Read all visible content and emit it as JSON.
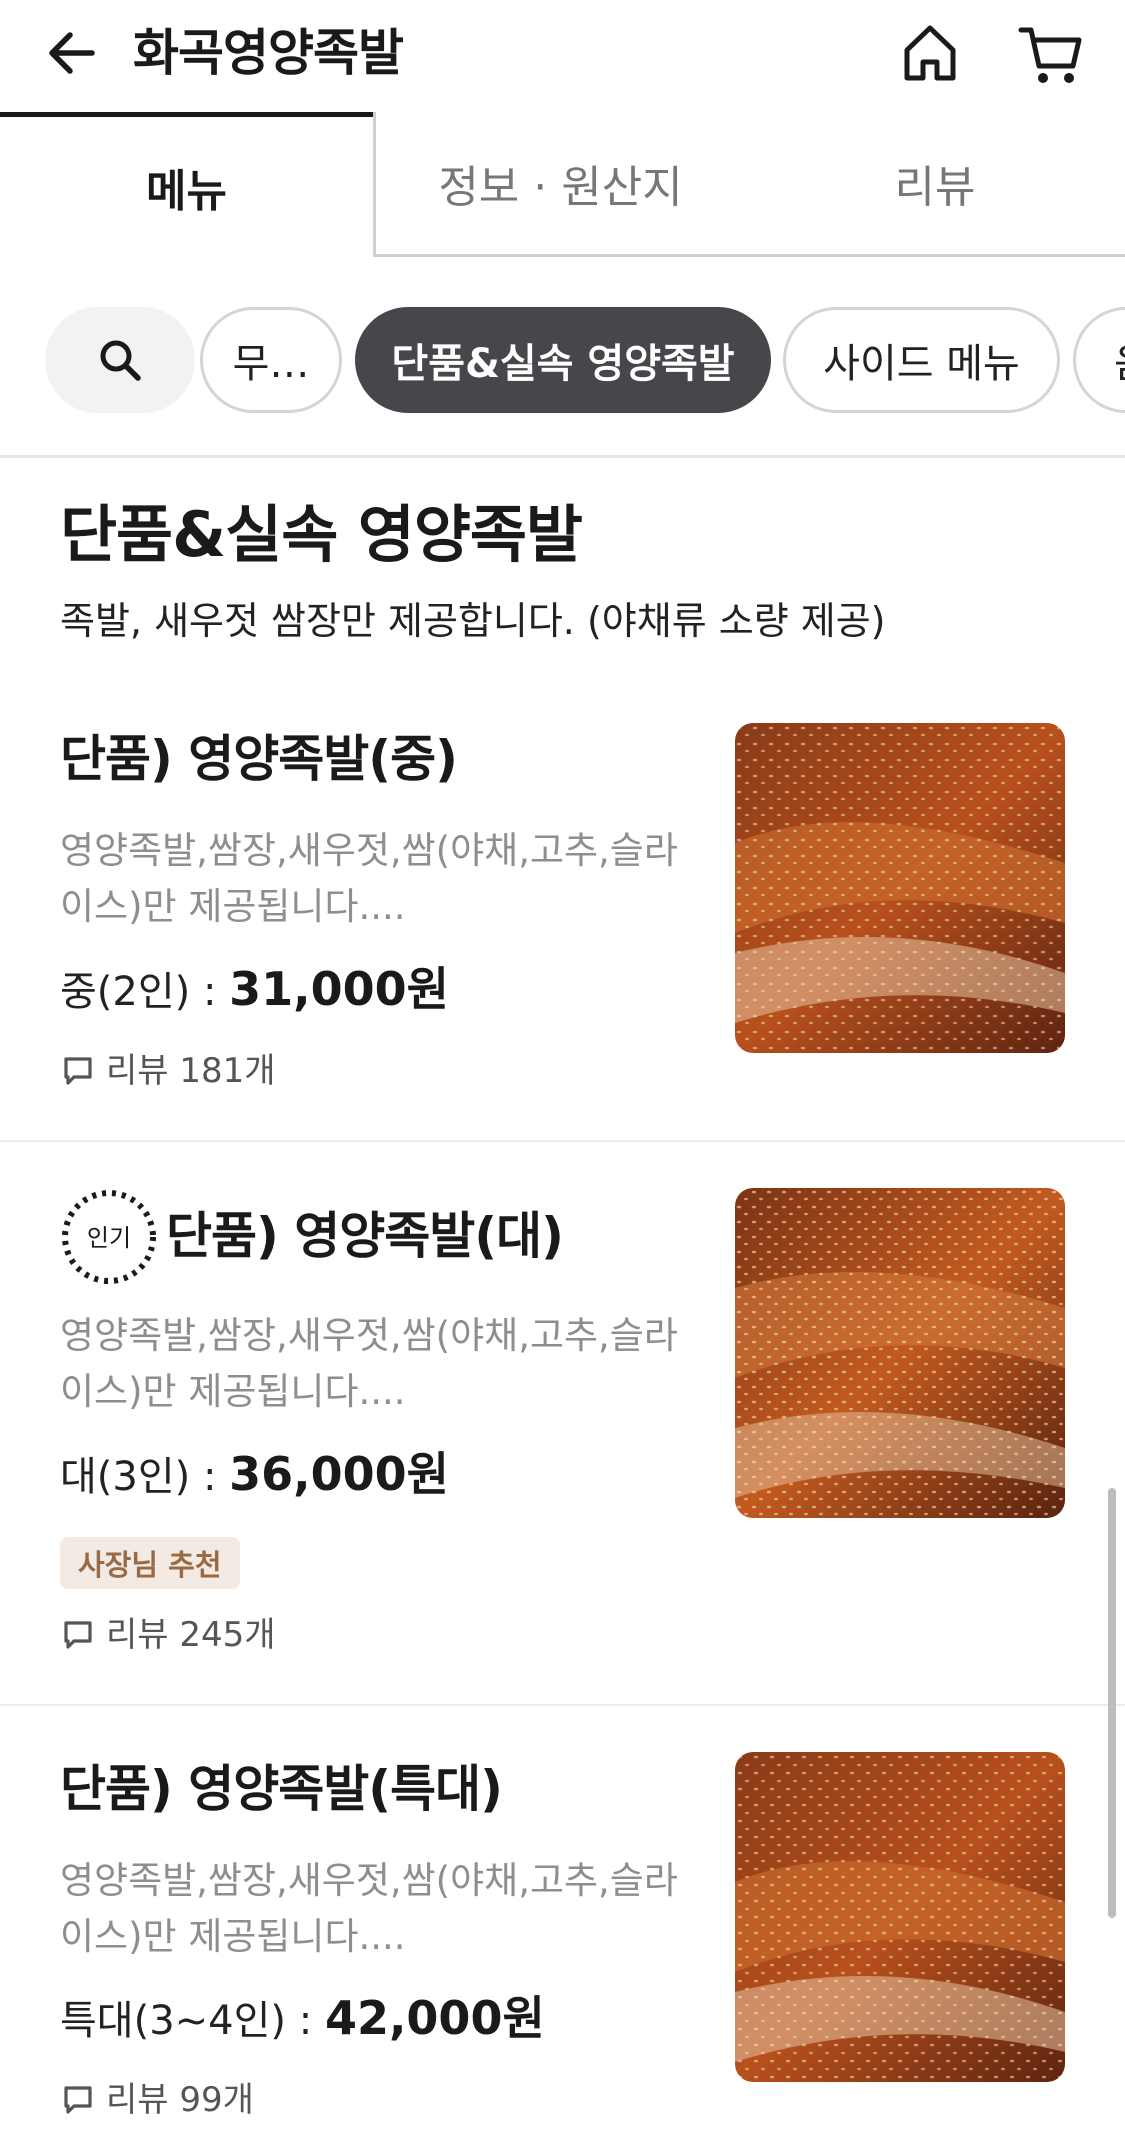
{
  "header": {
    "title": "화곡영양족발",
    "back_icon": "arrow-left-icon",
    "home_icon": "home-icon",
    "cart_icon": "cart-icon"
  },
  "tabs": [
    {
      "label": "메뉴",
      "active": true
    },
    {
      "label": "정보 · 원산지",
      "active": false
    },
    {
      "label": "리뷰",
      "active": false
    }
  ],
  "chips": {
    "search_icon": "search-icon",
    "items": [
      {
        "label": "무…",
        "selected": false
      },
      {
        "label": "단품&실속 영양족발",
        "selected": true
      },
      {
        "label": "사이드 메뉴",
        "selected": false
      },
      {
        "label": "음",
        "selected": false
      }
    ]
  },
  "section": {
    "title": "단품&실속 영양족발",
    "description": "족발, 새우젓 쌈장만 제공합니다. (야채류 소량 제공)"
  },
  "menu_items": [
    {
      "name": "단품) 영양족발(중)",
      "description": "영양족발,쌈장,새우젓,쌈(야채,고추,슬라이스)만 제공됩니다....",
      "price_label": "중(2인) : ",
      "price": "31,000원",
      "review": "리뷰 181개",
      "popular": false,
      "badge": ""
    },
    {
      "name": "단품) 영양족발(대)",
      "description": "영양족발,쌈장,새우젓,쌈(야채,고추,슬라이스)만 제공됩니다....",
      "price_label": "대(3인) : ",
      "price": "36,000원",
      "review": "리뷰 245개",
      "popular": true,
      "popular_label": "인기",
      "badge": "사장님 추천"
    },
    {
      "name": "단품) 영양족발(특대)",
      "description": "영양족발,쌈장,새우젓,쌈(야채,고추,슬라이스)만 제공됩니다....",
      "price_label": "특대(3~4인) : ",
      "price": "42,000원",
      "review": "리뷰 99개",
      "popular": false,
      "badge": ""
    }
  ],
  "colors": {
    "active_chip_bg": "#45474b",
    "badge_bg": "#f3ebe3",
    "badge_text": "#9a6a45"
  }
}
